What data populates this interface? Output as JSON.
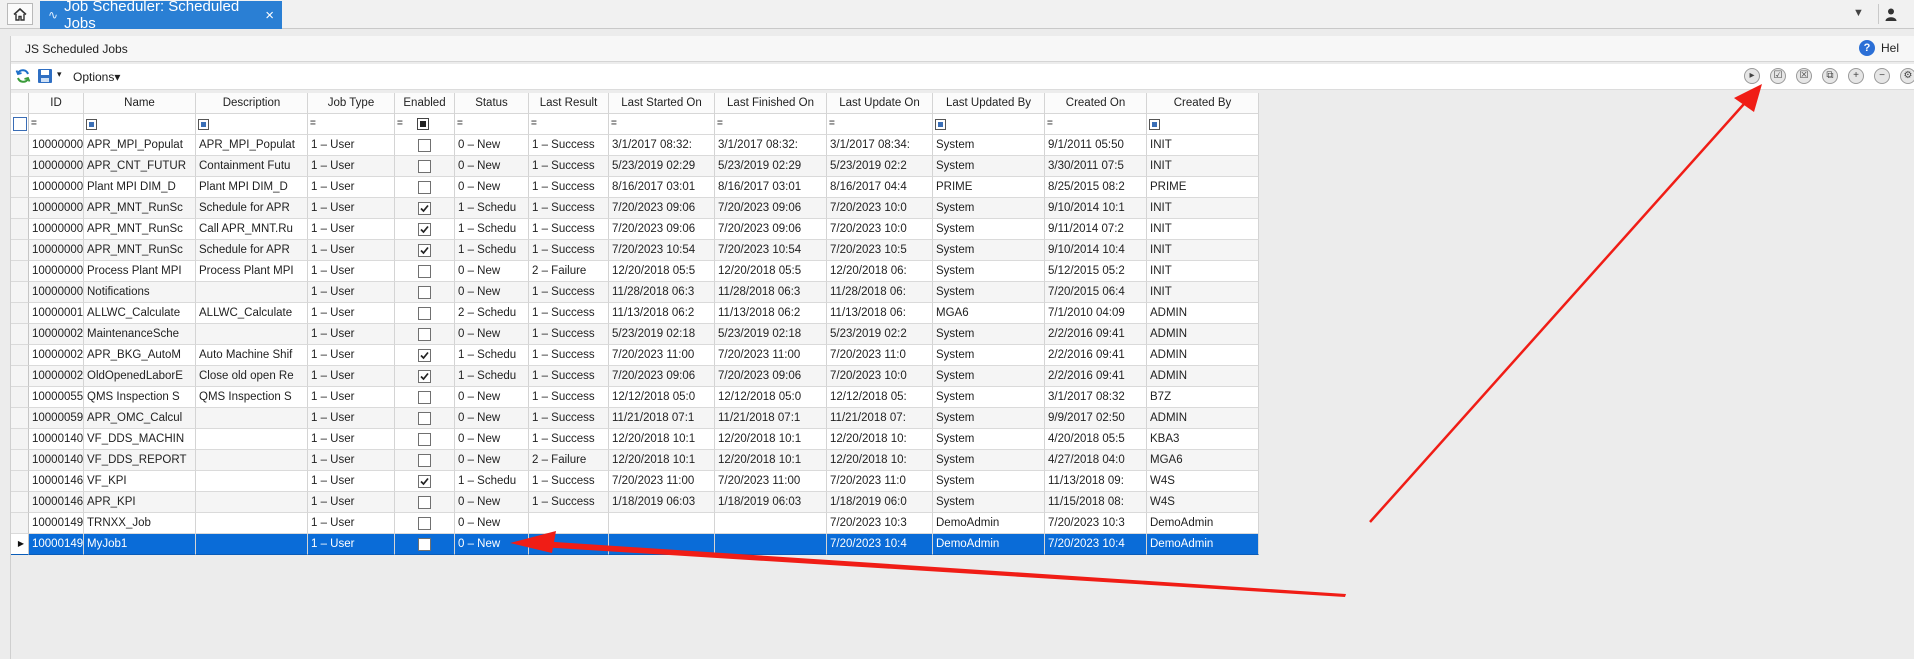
{
  "tab": {
    "title": "Job Scheduler: Scheduled Jobs",
    "close": "×"
  },
  "panel": {
    "title": "JS Scheduled Jobs",
    "help_label": "Hel"
  },
  "toolbar": {
    "options_label": "Options",
    "dropdown_caret": "▾"
  },
  "columns": [
    {
      "key": "id",
      "label": "ID",
      "width": 55
    },
    {
      "key": "name",
      "label": "Name",
      "width": 112
    },
    {
      "key": "description",
      "label": "Description",
      "width": 112
    },
    {
      "key": "jobtype",
      "label": "Job Type",
      "width": 87
    },
    {
      "key": "enabled",
      "label": "Enabled",
      "width": 60
    },
    {
      "key": "status",
      "label": "Status",
      "width": 74
    },
    {
      "key": "lastresult",
      "label": "Last Result",
      "width": 80
    },
    {
      "key": "laststart",
      "label": "Last Started On",
      "width": 106
    },
    {
      "key": "lastfinish",
      "label": "Last Finished On",
      "width": 112
    },
    {
      "key": "lastupdate",
      "label": "Last Update On",
      "width": 106
    },
    {
      "key": "updatedby",
      "label": "Last Updated By",
      "width": 112
    },
    {
      "key": "createdon",
      "label": "Created On",
      "width": 102
    },
    {
      "key": "createdby",
      "label": "Created By",
      "width": 112
    }
  ],
  "rows": [
    {
      "id": "10000000",
      "name": "APR_MPI_Populat",
      "description": "APR_MPI_Populat",
      "jobtype": "1 – User",
      "enabled": false,
      "status": "0 – New",
      "lastresult": "1 – Success",
      "laststart": "3/1/2017 08:32:",
      "lastfinish": "3/1/2017 08:32:",
      "lastupdate": "3/1/2017 08:34:",
      "updatedby": "System",
      "createdon": "9/1/2011 05:50",
      "createdby": "INIT"
    },
    {
      "id": "10000000",
      "name": "APR_CNT_FUTUR",
      "description": "Containment Futu",
      "jobtype": "1 – User",
      "enabled": false,
      "status": "0 – New",
      "lastresult": "1 – Success",
      "laststart": "5/23/2019 02:29",
      "lastfinish": "5/23/2019 02:29",
      "lastupdate": "5/23/2019 02:2",
      "updatedby": "System",
      "createdon": "3/30/2011 07:5",
      "createdby": "INIT"
    },
    {
      "id": "10000000",
      "name": "Plant MPI DIM_D",
      "description": "Plant MPI DIM_D",
      "jobtype": "1 – User",
      "enabled": false,
      "status": "0 – New",
      "lastresult": "1 – Success",
      "laststart": "8/16/2017 03:01",
      "lastfinish": "8/16/2017 03:01",
      "lastupdate": "8/16/2017 04:4",
      "updatedby": "PRIME",
      "createdon": "8/25/2015 08:2",
      "createdby": "PRIME"
    },
    {
      "id": "10000000",
      "name": "APR_MNT_RunSc",
      "description": "Schedule for APR",
      "jobtype": "1 – User",
      "enabled": true,
      "status": "1 – Schedu",
      "lastresult": "1 – Success",
      "laststart": "7/20/2023 09:06",
      "lastfinish": "7/20/2023 09:06",
      "lastupdate": "7/20/2023 10:0",
      "updatedby": "System",
      "createdon": "9/10/2014 10:1",
      "createdby": "INIT"
    },
    {
      "id": "10000000",
      "name": "APR_MNT_RunSc",
      "description": "Call APR_MNT.Ru",
      "jobtype": "1 – User",
      "enabled": true,
      "status": "1 – Schedu",
      "lastresult": "1 – Success",
      "laststart": "7/20/2023 09:06",
      "lastfinish": "7/20/2023 09:06",
      "lastupdate": "7/20/2023 10:0",
      "updatedby": "System",
      "createdon": "9/11/2014 07:2",
      "createdby": "INIT"
    },
    {
      "id": "10000000",
      "name": "APR_MNT_RunSc",
      "description": "Schedule for APR",
      "jobtype": "1 – User",
      "enabled": true,
      "status": "1 – Schedu",
      "lastresult": "1 – Success",
      "laststart": "7/20/2023 10:54",
      "lastfinish": "7/20/2023 10:54",
      "lastupdate": "7/20/2023 10:5",
      "updatedby": "System",
      "createdon": "9/10/2014 10:4",
      "createdby": "INIT"
    },
    {
      "id": "10000000",
      "name": "Process Plant MPI",
      "description": "Process Plant MPI",
      "jobtype": "1 – User",
      "enabled": false,
      "status": "0 – New",
      "lastresult": "2 – Failure",
      "laststart": "12/20/2018 05:5",
      "lastfinish": "12/20/2018 05:5",
      "lastupdate": "12/20/2018 06:",
      "updatedby": "System",
      "createdon": "5/12/2015 05:2",
      "createdby": "INIT"
    },
    {
      "id": "10000000",
      "name": "Notifications",
      "description": "",
      "jobtype": "1 – User",
      "enabled": false,
      "status": "0 – New",
      "lastresult": "1 – Success",
      "laststart": "11/28/2018 06:3",
      "lastfinish": "11/28/2018 06:3",
      "lastupdate": "11/28/2018 06:",
      "updatedby": "System",
      "createdon": "7/20/2015 06:4",
      "createdby": "INIT"
    },
    {
      "id": "10000001",
      "name": "ALLWC_Calculate",
      "description": "ALLWC_Calculate",
      "jobtype": "1 – User",
      "enabled": false,
      "status": "2 – Schedu",
      "lastresult": "1 – Success",
      "laststart": "11/13/2018 06:2",
      "lastfinish": "11/13/2018 06:2",
      "lastupdate": "11/13/2018 06:",
      "updatedby": "MGA6",
      "createdon": "7/1/2010 04:09",
      "createdby": "ADMIN"
    },
    {
      "id": "10000002",
      "name": "MaintenanceSche",
      "description": "",
      "jobtype": "1 – User",
      "enabled": false,
      "status": "0 – New",
      "lastresult": "1 – Success",
      "laststart": "5/23/2019 02:18",
      "lastfinish": "5/23/2019 02:18",
      "lastupdate": "5/23/2019 02:2",
      "updatedby": "System",
      "createdon": "2/2/2016 09:41",
      "createdby": "ADMIN"
    },
    {
      "id": "10000002",
      "name": "APR_BKG_AutoM",
      "description": "Auto Machine Shif",
      "jobtype": "1 – User",
      "enabled": true,
      "status": "1 – Schedu",
      "lastresult": "1 – Success",
      "laststart": "7/20/2023 11:00",
      "lastfinish": "7/20/2023 11:00",
      "lastupdate": "7/20/2023 11:0",
      "updatedby": "System",
      "createdon": "2/2/2016 09:41",
      "createdby": "ADMIN"
    },
    {
      "id": "10000002",
      "name": "OldOpenedLaborE",
      "description": "Close old open Re",
      "jobtype": "1 – User",
      "enabled": true,
      "status": "1 – Schedu",
      "lastresult": "1 – Success",
      "laststart": "7/20/2023 09:06",
      "lastfinish": "7/20/2023 09:06",
      "lastupdate": "7/20/2023 10:0",
      "updatedby": "System",
      "createdon": "2/2/2016 09:41",
      "createdby": "ADMIN"
    },
    {
      "id": "10000055",
      "name": "QMS Inspection S",
      "description": "QMS Inspection S",
      "jobtype": "1 – User",
      "enabled": false,
      "status": "0 – New",
      "lastresult": "1 – Success",
      "laststart": "12/12/2018 05:0",
      "lastfinish": "12/12/2018 05:0",
      "lastupdate": "12/12/2018 05:",
      "updatedby": "System",
      "createdon": "3/1/2017 08:32",
      "createdby": "B7Z"
    },
    {
      "id": "10000059",
      "name": "APR_OMC_Calcul",
      "description": "",
      "jobtype": "1 – User",
      "enabled": false,
      "status": "0 – New",
      "lastresult": "1 – Success",
      "laststart": "11/21/2018 07:1",
      "lastfinish": "11/21/2018 07:1",
      "lastupdate": "11/21/2018 07:",
      "updatedby": "System",
      "createdon": "9/9/2017 02:50",
      "createdby": "ADMIN"
    },
    {
      "id": "10000140",
      "name": "VF_DDS_MACHIN",
      "description": "",
      "jobtype": "1 – User",
      "enabled": false,
      "status": "0 – New",
      "lastresult": "1 – Success",
      "laststart": "12/20/2018 10:1",
      "lastfinish": "12/20/2018 10:1",
      "lastupdate": "12/20/2018 10:",
      "updatedby": "System",
      "createdon": "4/20/2018 05:5",
      "createdby": "KBA3"
    },
    {
      "id": "10000140",
      "name": "VF_DDS_REPORT",
      "description": "",
      "jobtype": "1 – User",
      "enabled": false,
      "status": "0 – New",
      "lastresult": "2 – Failure",
      "laststart": "12/20/2018 10:1",
      "lastfinish": "12/20/2018 10:1",
      "lastupdate": "12/20/2018 10:",
      "updatedby": "System",
      "createdon": "4/27/2018 04:0",
      "createdby": "MGA6"
    },
    {
      "id": "10000146",
      "name": "VF_KPI",
      "description": "",
      "jobtype": "1 – User",
      "enabled": true,
      "status": "1 – Schedu",
      "lastresult": "1 – Success",
      "laststart": "7/20/2023 11:00",
      "lastfinish": "7/20/2023 11:00",
      "lastupdate": "7/20/2023 11:0",
      "updatedby": "System",
      "createdon": "11/13/2018 09:",
      "createdby": "W4S"
    },
    {
      "id": "10000146",
      "name": "APR_KPI",
      "description": "",
      "jobtype": "1 – User",
      "enabled": false,
      "status": "0 – New",
      "lastresult": "1 – Success",
      "laststart": "1/18/2019 06:03",
      "lastfinish": "1/18/2019 06:03",
      "lastupdate": "1/18/2019 06:0",
      "updatedby": "System",
      "createdon": "11/15/2018 08:",
      "createdby": "W4S"
    },
    {
      "id": "10000149",
      "name": "TRNXX_Job",
      "description": "",
      "jobtype": "1 – User",
      "enabled": false,
      "status": "0 – New",
      "lastresult": "",
      "laststart": "",
      "lastfinish": "",
      "lastupdate": "7/20/2023 10:3",
      "updatedby": "DemoAdmin",
      "createdon": "7/20/2023 10:3",
      "createdby": "DemoAdmin"
    },
    {
      "id": "10000149",
      "name": "MyJob1",
      "description": "",
      "jobtype": "1 – User",
      "enabled": false,
      "status": "0 – New",
      "lastresult": "",
      "laststart": "",
      "lastfinish": "",
      "lastupdate": "7/20/2023 10:4",
      "updatedby": "DemoAdmin",
      "createdon": "7/20/2023 10:4",
      "createdby": "DemoAdmin",
      "selected": true
    }
  ],
  "colors": {
    "tab_active": "#2a7fd4",
    "row_selected": "#0a6cd8",
    "annotation_arrow": "#f01d16"
  },
  "icons": {
    "home": "home-icon",
    "user": "user-icon",
    "refresh": "refresh-icon",
    "save_layout": "save-icon",
    "help": "help-icon",
    "toolbar_right": [
      "play-icon",
      "enable-icon",
      "disable-icon",
      "copy-icon",
      "add-icon",
      "remove-icon",
      "settings-icon"
    ]
  }
}
